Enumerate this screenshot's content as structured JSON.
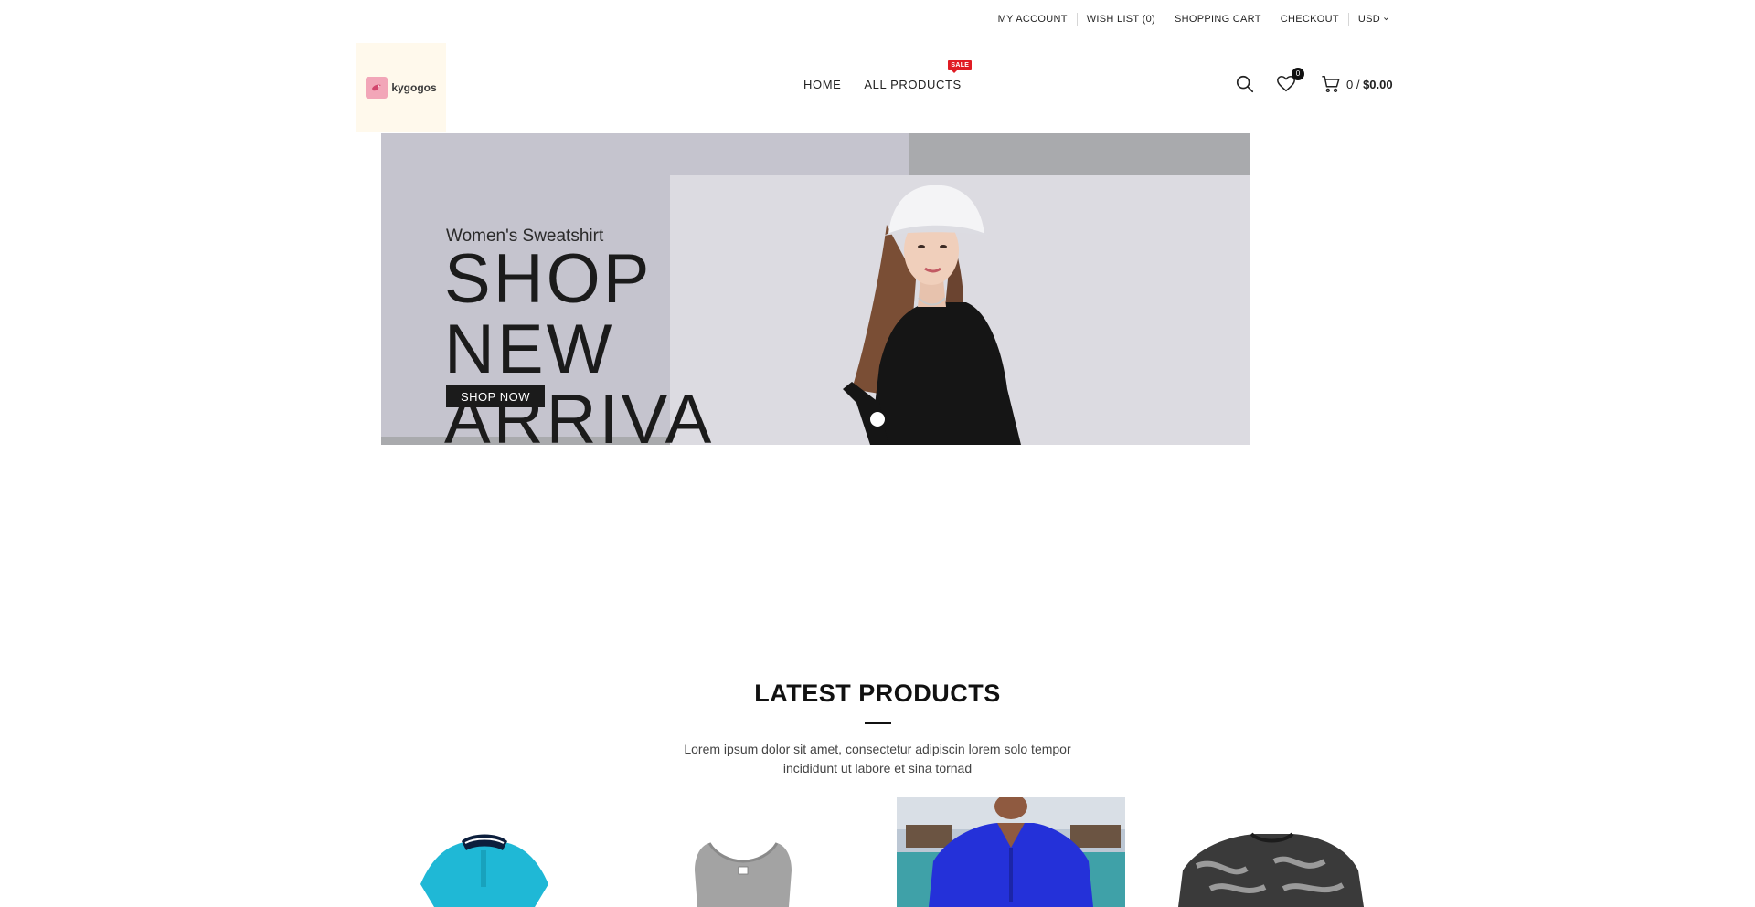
{
  "topbar": {
    "my_account": "MY ACCOUNT",
    "wish_list": "WISH LIST (0)",
    "shopping_cart": "SHOPPING CART",
    "checkout": "CHECKOUT",
    "currency": "USD"
  },
  "logo": {
    "text": "kygogos",
    "icon": "bird-icon"
  },
  "nav": {
    "home": "HOME",
    "all_products": "ALL PRODUCTS",
    "sale_badge": "SALE"
  },
  "header": {
    "search_icon": "search-icon",
    "wishlist_icon": "heart-icon",
    "wishlist_count": "0",
    "cart_icon": "cart-icon",
    "cart_count": "0",
    "cart_separator": " / ",
    "cart_total": "$0.00"
  },
  "hero": {
    "subtitle": "Women's Sweatshirt",
    "title_line1": "SHOP",
    "title_line2": "NEW",
    "title_line3": "ARRIVA",
    "cta": "SHOP NOW",
    "slide_dots": 1
  },
  "latest": {
    "title": "LATEST PRODUCTS",
    "description": "Lorem ipsum dolor sit amet, consectetur adipiscin lorem solo tempor incididunt ut labore et sina tornad"
  },
  "products": [
    {
      "name": "cyan polo shirt",
      "color": "#1fb8d6"
    },
    {
      "name": "grey tank top",
      "color": "#a3a3a3"
    },
    {
      "name": "blue polo shirt",
      "color": "#2431d9"
    },
    {
      "name": "black grey knit sweater",
      "color": "#3a3a3a"
    }
  ],
  "colors": {
    "sale": "#e01c24",
    "logo_bg": "#fff9ec",
    "text": "#222222"
  }
}
